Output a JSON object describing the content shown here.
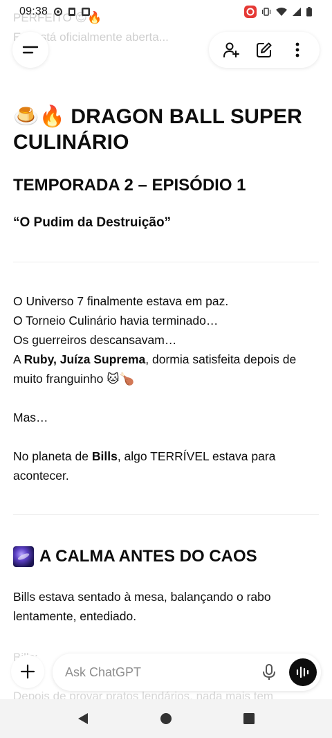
{
  "status_bar": {
    "time": "09:38"
  },
  "ghost": {
    "line1": "PERFEITO 😍🔥",
    "line2": "E o está oficialmente aberta..."
  },
  "header": {
    "menu_icon": "menu-icon",
    "actions": [
      "add-person-icon",
      "edit-icon",
      "more-vertical-icon"
    ]
  },
  "article": {
    "title_emoji": "🍮🔥",
    "title": "DRAGON BALL SUPER CULINÁRIO",
    "season": "TEMPORADA 2 – EPISÓDIO 1",
    "episode_title": "“O Pudim da Destruição”",
    "p1_l1": "O Universo 7 finalmente estava em paz.",
    "p1_l2": "O Torneio Culinário havia terminado…",
    "p1_l3": "Os guerreiros descansavam…",
    "p1_l4_pre": "A ",
    "p1_l4_bold": "Ruby, Juíza Suprema",
    "p1_l4_post": ", dormia satisfeita depois de muito franguinho 🐱🍗",
    "p2": "Mas…",
    "p3_pre": "No planeta de ",
    "p3_bold": "Bills",
    "p3_post": ", algo TERRÍVEL estava para acontecer.",
    "section_title": "A CALMA ANTES DO CAOS",
    "section_icon": "galaxy-icon",
    "p4": "Bills estava sentado à mesa, balançando o rabo lentamente, entediado.",
    "fade1": "Bills:",
    "fade2": "Depois de provar pratos lendários, nada mais tem"
  },
  "composer": {
    "placeholder": "Ask ChatGPT",
    "value": ""
  },
  "colors": {
    "text": "#0d0d0d",
    "placeholder": "#8e8e8e",
    "voice_button": "#0d0d0d",
    "status_red": "#e53935"
  }
}
